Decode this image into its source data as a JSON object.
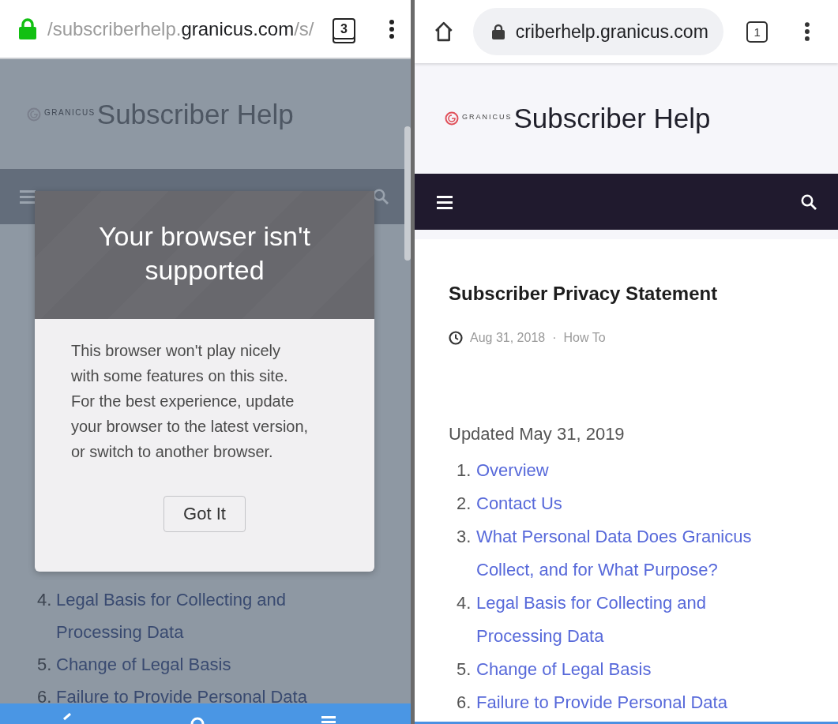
{
  "left_browser": {
    "address_bar": {
      "url_parts": [
        {
          "text": "/subscriberhelp.",
          "kind": "dim"
        },
        {
          "text": "granicus.com",
          "kind": "domain"
        },
        {
          "text": "/s/",
          "kind": "dim"
        }
      ],
      "tab_count": "3"
    },
    "site_header": {
      "logo_text": "GRANICUS",
      "title": "Subscriber Help"
    },
    "page": {
      "toc": [
        {
          "number": "4.",
          "title": "Legal Basis for Collecting and Processing Data"
        },
        {
          "number": "5.",
          "title": "Change of Legal Basis"
        },
        {
          "number": "6.",
          "title": "Failure to Provide Personal Data"
        }
      ]
    },
    "dialog": {
      "title": "Your browser isn't supported",
      "message": "This browser won't play nicely with some features on this site. For the best experience, update your browser to the latest version, or switch to another browser.",
      "button": "Got It"
    }
  },
  "right_browser": {
    "address_bar": {
      "url": "criberhelp.granicus.com",
      "tab_count": "1"
    },
    "site_header": {
      "logo_text": "GRANICUS",
      "title": "Subscriber Help"
    },
    "article": {
      "title": "Subscriber Privacy Statement",
      "date": "Aug 31, 2018",
      "separator": "·",
      "category": "How To",
      "updated": "Updated May 31, 2019",
      "toc": [
        {
          "number": "1.",
          "title": "Overview"
        },
        {
          "number": "2.",
          "title": "Contact Us"
        },
        {
          "number": "3.",
          "title": "What Personal Data Does Granicus Collect, and for What Purpose?"
        },
        {
          "number": "4.",
          "title": "Legal Basis for Collecting and Processing Data"
        },
        {
          "number": "5.",
          "title": "Change of Legal Basis"
        },
        {
          "number": "6.",
          "title": "Failure to Provide Personal Data"
        }
      ]
    }
  }
}
